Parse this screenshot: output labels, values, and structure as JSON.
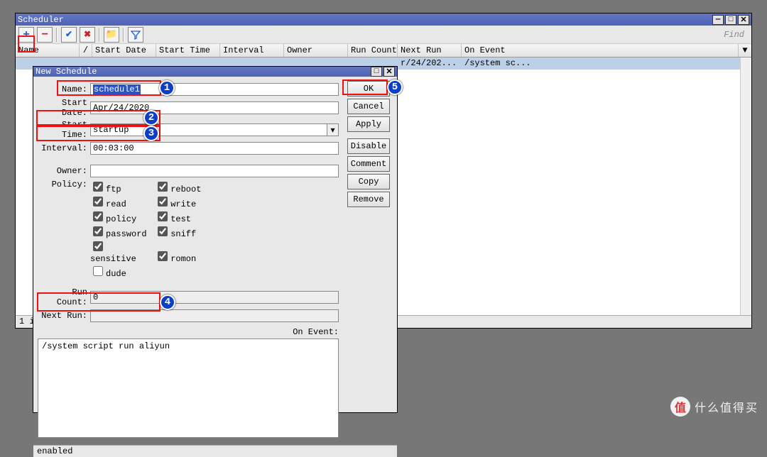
{
  "scheduler_win": {
    "title": "Scheduler",
    "find_label": "Find",
    "columns": {
      "name": "Name",
      "sort": "/",
      "start_date": "Start Date",
      "start_time": "Start Time",
      "interval": "Interval",
      "owner": "Owner",
      "run_count": "Run Count",
      "next_run": "Next Run",
      "on_event": "On Event"
    },
    "row": {
      "next_run": "r/24/202...",
      "on_event": "/system sc..."
    },
    "row_count_label": "1 i",
    "menu_caret": "▼",
    "plus_glyph": "+",
    "minus_glyph": "−",
    "check_glyph": "✔",
    "x_glyph": "✖",
    "folder_glyph": "📁",
    "filter_glyph": "▿"
  },
  "dialog": {
    "title": "New Schedule",
    "labels": {
      "name": "Name:",
      "start_date": "Start Date:",
      "start_time": "Start Time:",
      "interval": "Interval:",
      "owner": "Owner:",
      "policy": "Policy:",
      "run_count": "Run Count:",
      "next_run": "Next Run:",
      "on_event": "On Event:"
    },
    "values": {
      "name": "schedule1",
      "start_date": "Apr/24/2020",
      "start_time": "startup",
      "interval": "00:03:00",
      "owner": "",
      "run_count": "0",
      "next_run": "",
      "on_event_script": "/system script run aliyun"
    },
    "policy": {
      "ftp": {
        "label": "ftp",
        "checked": true
      },
      "read": {
        "label": "read",
        "checked": true
      },
      "policy": {
        "label": "policy",
        "checked": true
      },
      "password": {
        "label": "password",
        "checked": true
      },
      "sensitive": {
        "label": "sensitive",
        "checked": true
      },
      "dude": {
        "label": "dude",
        "checked": false
      },
      "reboot": {
        "label": "reboot",
        "checked": true
      },
      "write": {
        "label": "write",
        "checked": true
      },
      "test": {
        "label": "test",
        "checked": true
      },
      "sniff": {
        "label": "sniff",
        "checked": true
      },
      "romon": {
        "label": "romon",
        "checked": true
      }
    },
    "buttons": {
      "ok": "OK",
      "cancel": "Cancel",
      "apply": "Apply",
      "disable": "Disable",
      "comment": "Comment",
      "copy": "Copy",
      "remove": "Remove"
    },
    "status": "enabled",
    "dd_glyph": "▾"
  },
  "annotations": {
    "b1": "1",
    "b2": "2",
    "b3": "3",
    "b4": "4",
    "b5": "5"
  },
  "watermark": {
    "text": "什么值得买",
    "logo": "值"
  }
}
